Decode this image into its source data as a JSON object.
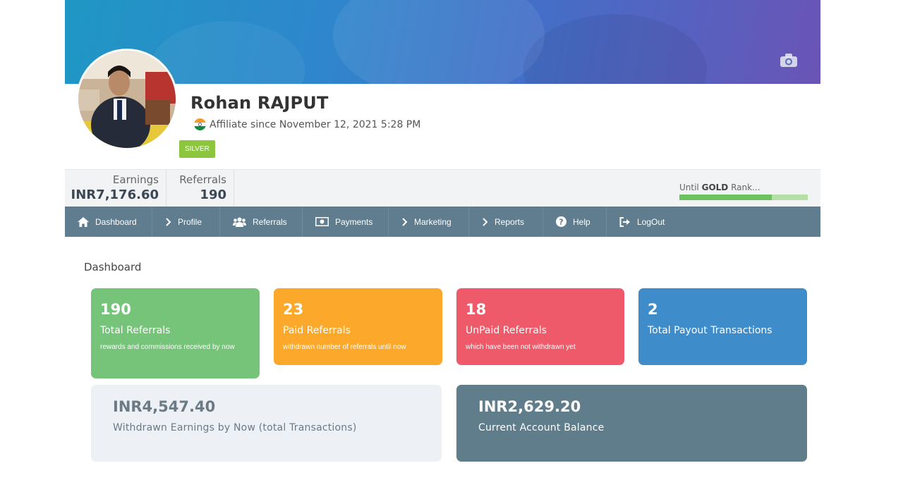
{
  "profile": {
    "name": "Rohan RAJPUT",
    "since": "Affiliate since November 12, 2021 5:28 PM",
    "rank_badge": "SILVER"
  },
  "stats": {
    "earnings_label": "Earnings",
    "earnings_value": "INR7,176.60",
    "referrals_label": "Referrals",
    "referrals_value": "190",
    "rank_prefix": "Until",
    "rank_name": "GOLD",
    "rank_suffix": "Rank...",
    "rank_progress": 0.72
  },
  "nav": [
    {
      "label": "Dashboard",
      "icon": "home-icon"
    },
    {
      "label": "Profile",
      "icon": "chevron-right-icon"
    },
    {
      "label": "Referrals",
      "icon": "users-icon"
    },
    {
      "label": "Payments",
      "icon": "money-icon"
    },
    {
      "label": "Marketing",
      "icon": "chevron-right-icon"
    },
    {
      "label": "Reports",
      "icon": "chevron-right-icon"
    },
    {
      "label": "Help",
      "icon": "question-circle-icon"
    },
    {
      "label": "LogOut",
      "icon": "sign-out-icon"
    }
  ],
  "section_title": "Dashboard",
  "cards": [
    {
      "number": "190",
      "title": "Total Referrals",
      "sub": "rewards and commissions received by now",
      "color": "#76c37a"
    },
    {
      "number": "23",
      "title": "Paid Referrals",
      "sub": "withdrawn number of referrals until now",
      "color": "#fba82b"
    },
    {
      "number": "18",
      "title": "UnPaid Referrals",
      "sub": "which have been not withdrawn yet",
      "color": "#ef5a6b"
    },
    {
      "number": "2",
      "title": "Total Payout Transactions",
      "sub": "",
      "color": "#3f8ccb"
    }
  ],
  "balances": [
    {
      "amount": "INR4,547.40",
      "label": "Withdrawn Earnings by Now (total Transactions)"
    },
    {
      "amount": "INR2,629.20",
      "label": "Current Account Balance"
    }
  ],
  "colors": {
    "nav_bg": "#5f7d8f",
    "badge": "#8cc63f",
    "rank_fill": "#6cc35e"
  }
}
